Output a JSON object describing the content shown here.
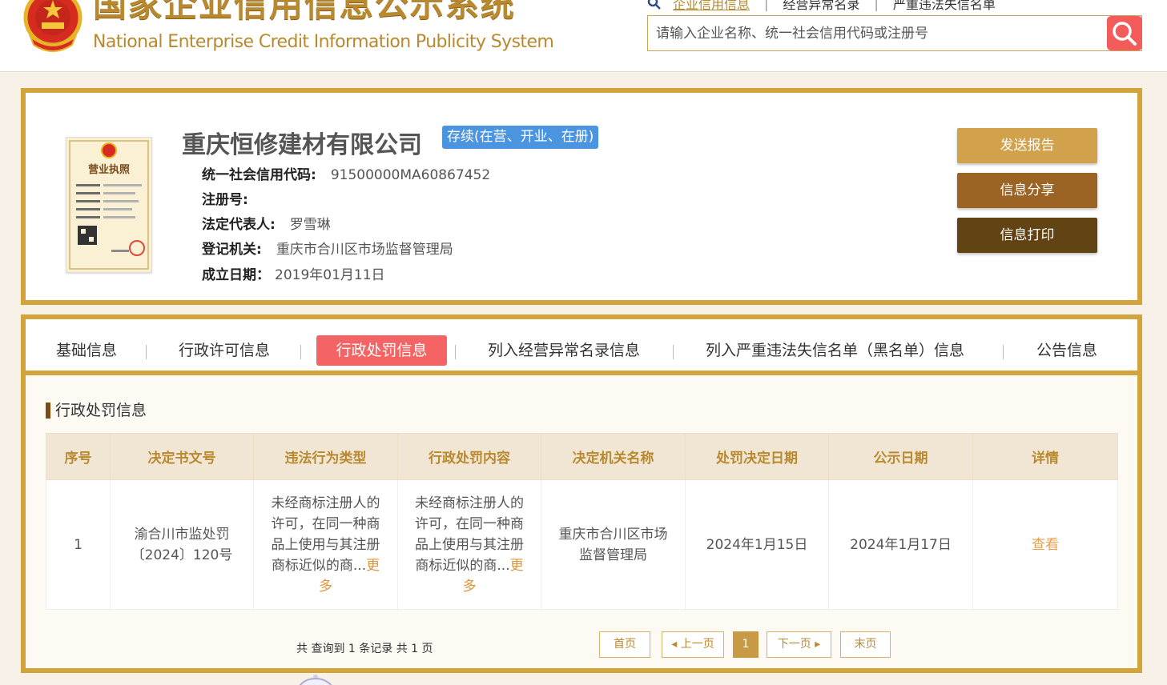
{
  "header": {
    "logo_cn": "国家企业信用信息公示系统",
    "logo_en": "National Enterprise Credit Information Publicity System",
    "search_links": [
      "企业信用信息",
      "经营异常名录",
      "严重违法失信名单"
    ],
    "search_placeholder": "请输入企业名称、统一社会信用代码或注册号"
  },
  "company": {
    "name": "重庆恒修建材有限公司",
    "status": "存续(在营、开业、在册)",
    "license_title": "营业执照",
    "fields": [
      {
        "label": "统一社会信用代码:",
        "value": "91500000MA60867452"
      },
      {
        "label": "注册号:",
        "value": ""
      },
      {
        "label": "法定代表人:",
        "value": "罗雪琳"
      },
      {
        "label": "登记机关:",
        "value": "重庆市合川区市场监督管理局"
      },
      {
        "label": "成立日期：",
        "value": "2019年01月11日"
      }
    ],
    "actions": [
      {
        "label": "发送报告",
        "color": "#d1a14c"
      },
      {
        "label": "信息分享",
        "color": "#9b6324"
      },
      {
        "label": "信息打印",
        "color": "#614314"
      }
    ]
  },
  "tabs": [
    {
      "label": "基础信息",
      "active": false
    },
    {
      "label": "行政许可信息",
      "active": false
    },
    {
      "label": "行政处罚信息",
      "active": true
    },
    {
      "label": "列入经营异常名录信息",
      "active": false
    },
    {
      "label": "列入严重违法失信名单（黑名单）信息",
      "active": false
    },
    {
      "label": "公告信息",
      "active": false
    }
  ],
  "section_title": "行政处罚信息",
  "table": {
    "headers": [
      "序号",
      "决定书文号",
      "违法行为类型",
      "行政处罚内容",
      "决定机关名称",
      "处罚决定日期",
      "公示日期",
      "详情"
    ],
    "rows": [
      {
        "index": "1",
        "doc_no": "渝合川市监处罚〔2024〕120号",
        "violation": "未经商标注册人的许可，在同一种商品上使用与其注册商标近似的商...",
        "violation_more": "更多",
        "content": "未经商标注册人的许可，在同一种商品上使用与其注册商标近似的商...",
        "content_more": "更多",
        "authority": "重庆市合川区市场监督管理局",
        "decision_date": "2024年1月15日",
        "publish_date": "2024年1月17日",
        "detail": "查看"
      }
    ]
  },
  "pager": {
    "total": "共 查询到 1 条记录 共 1 页",
    "first": "首页",
    "prev": "上一页",
    "current": "1",
    "next": "下一页",
    "last": "末页"
  },
  "colors": {
    "gold": "#d3a33c",
    "accent_red": "#f46464",
    "status_blue": "#4b94e0",
    "header_gold": "#b8892e"
  }
}
